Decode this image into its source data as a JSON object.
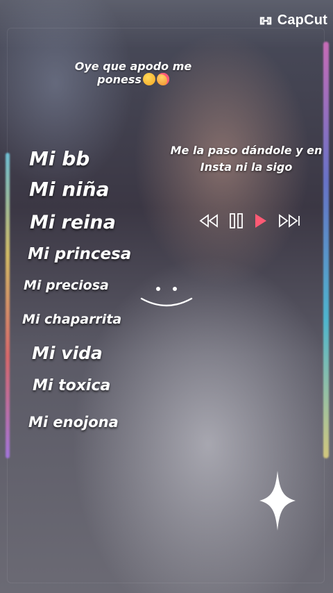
{
  "brand": {
    "name": "CapCut"
  },
  "captions": {
    "top_line1": "Oye que apodo me",
    "top_line2": "poness",
    "right_line1": "Me la paso dándole y en",
    "right_line2": "Insta ni la sigo"
  },
  "nicknames": [
    "Mi bb",
    "Mi niña",
    "Mi reina",
    "Mi princesa",
    "Mi preciosa",
    "Mi chaparrita",
    "Mi vida",
    "Mi toxica",
    "Mi enojona"
  ],
  "player_controls": {
    "icons": [
      "rewind-icon",
      "pause-icon",
      "play-icon",
      "fast-forward-icon"
    ],
    "accent_color": "#ff5a74"
  },
  "emoji_icons": [
    "kiss-face-icon",
    "smiling-hearts-face-icon"
  ],
  "decor_icons": [
    "smile-face-icon",
    "sparkle-star-icon"
  ]
}
